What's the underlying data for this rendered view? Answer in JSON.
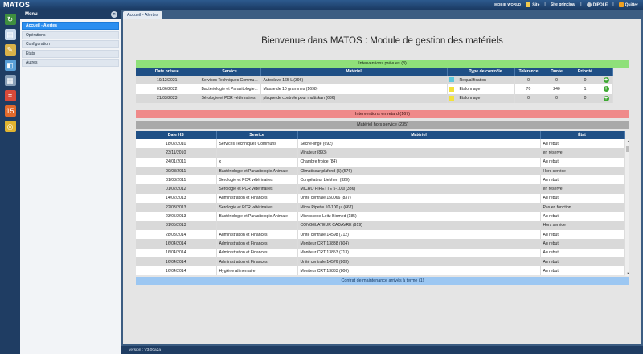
{
  "app": {
    "title": "MATOS"
  },
  "topbar": {
    "logo": "MOBIE WORLD",
    "links": [
      "Site",
      "Site principal"
    ],
    "user": "DIPOLE",
    "quit": "Quitter",
    "sep": "|"
  },
  "iconbar": [
    {
      "name": "refresh-icon",
      "color": "#3f8f3f",
      "glyph": "↻"
    },
    {
      "name": "document-icon",
      "color": "#c8d8ea",
      "glyph": "▤"
    },
    {
      "name": "edit-icon",
      "color": "#d9b24a",
      "glyph": "✎"
    },
    {
      "name": "truck-icon",
      "color": "#5aa0d8",
      "glyph": "◧"
    },
    {
      "name": "building-icon",
      "color": "#8aa0b8",
      "glyph": "▦"
    },
    {
      "name": "stack-icon",
      "color": "#d84a3a",
      "glyph": "≡"
    },
    {
      "name": "calendar-icon",
      "color": "#e26a2c",
      "glyph": "15"
    },
    {
      "name": "coins-icon",
      "color": "#e0b431",
      "glyph": "◎"
    }
  ],
  "sidebar": {
    "title": "Menu",
    "collapse": "«",
    "items": [
      {
        "label": "Accueil - Alertes",
        "active": true
      },
      {
        "label": "Opérations",
        "active": false
      },
      {
        "label": "Configuration",
        "active": false
      },
      {
        "label": "États",
        "active": false
      },
      {
        "label": "Autres",
        "active": false
      }
    ]
  },
  "tab": {
    "label": "Accueil - Alertes"
  },
  "welcome": "Bienvenue dans MATOS : Module de gestion des matériels",
  "interventions_prevues": {
    "title": "Interventions prévues (3)",
    "columns": [
      "Date prévue",
      "Service",
      "Matériel",
      "",
      "Type de contrôle",
      "Tolérance",
      "Durée",
      "Priorité",
      ""
    ],
    "rows": [
      {
        "date": "19/12/2021",
        "service": "Services Techniques Commu...",
        "materiel": "Autoclave 165 L (396)",
        "color": "#5ec8dc",
        "type": "Requalification",
        "tolerance": "0",
        "duree": "0",
        "priorite": "0"
      },
      {
        "date": "01/06/2022",
        "service": "Bactériologie et Parasitologie...",
        "materiel": "Masse de 10 grammes (1698)",
        "color": "#f2e23a",
        "type": "Etalonnage",
        "tolerance": "70",
        "duree": "240",
        "priorite": "1"
      },
      {
        "date": "21/03/2023",
        "service": "Sérologie et PCR vétérinaires",
        "materiel": "plaque de controle pour multiskan (636)",
        "color": "#f2e23a",
        "type": "Etalonnage",
        "tolerance": "0",
        "duree": "0",
        "priorite": "0"
      }
    ],
    "add_glyph": "+"
  },
  "interventions_retard": {
    "title": "Interventions en retard (167)"
  },
  "materiel_hs": {
    "title": "Matériel hors service (235)",
    "columns": [
      "Date HS",
      "Service",
      "Matériel",
      "État"
    ],
    "rows": [
      [
        "18/02/2010",
        "Services Techniques Communs",
        "Sèche-linge (692)",
        "Au rebut"
      ],
      [
        "23/11/2010",
        "",
        "Minuteur (893)",
        "en réserve"
      ],
      [
        "24/01/2011",
        "x",
        "Chambre froide (84)",
        "Au rebut"
      ],
      [
        "09/08/2011",
        "Bactériologie et Parasitologie Animale",
        "Climatiseur plafond (5) (576)",
        "Hors service"
      ],
      [
        "01/08/2011",
        "Sérologie et PCR vétérinaires",
        "Congélateur Liebherr (329)",
        "Au rebut"
      ],
      [
        "01/02/2012",
        "Sérologie et PCR vétérinaires",
        "MICRO PIPETTE 5-10µl (386)",
        "en réserve"
      ],
      [
        "14/02/2013",
        "Administration et Finances",
        "Unité centrale 150066 (837)",
        "Au rebut"
      ],
      [
        "22/03/2013",
        "Sérologie et PCR vétérinaires",
        "Micro Pipette 10-100 µl (667)",
        "Pas en fonction"
      ],
      [
        "23/05/2013",
        "Bactériologie et Parasitologie Animale",
        "Microscope Leitz Biomed (185)",
        "Au rebut"
      ],
      [
        "31/05/2013",
        "",
        "CONGELATEUR CADAVRE (919)",
        "Hors service"
      ],
      [
        "28/03/2014",
        "Administration et Finances",
        "Unité centrale 14598 (712)",
        "Au rebut"
      ],
      [
        "16/04/2014",
        "Administration et Finances",
        "Moniteur CRT 13838 (804)",
        "Au rebut"
      ],
      [
        "16/04/2014",
        "Administration et Finances",
        "Moniteur CRT 13853 (713)",
        "Au rebut"
      ],
      [
        "16/04/2014",
        "Administration et Finances",
        "Unité centrale 14576 (803)",
        "Au rebut"
      ],
      [
        "16/04/2014",
        "Hygiène alimentaire",
        "Moniteur CRT 13833 (806)",
        "Au rebut"
      ]
    ]
  },
  "contrats": {
    "title": "Contrat de maintenance arrivés à terme (1)"
  },
  "footer": {
    "version": "version : V3.00a2a"
  }
}
